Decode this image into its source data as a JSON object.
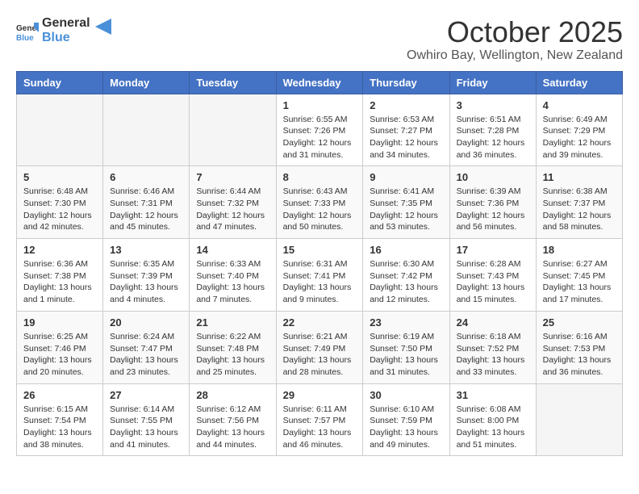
{
  "logo": {
    "general": "General",
    "blue": "Blue"
  },
  "title": "October 2025",
  "location": "Owhiro Bay, Wellington, New Zealand",
  "days_of_week": [
    "Sunday",
    "Monday",
    "Tuesday",
    "Wednesday",
    "Thursday",
    "Friday",
    "Saturday"
  ],
  "weeks": [
    [
      {
        "day": "",
        "info": ""
      },
      {
        "day": "",
        "info": ""
      },
      {
        "day": "",
        "info": ""
      },
      {
        "day": "1",
        "info": "Sunrise: 6:55 AM\nSunset: 7:26 PM\nDaylight: 12 hours and 31 minutes."
      },
      {
        "day": "2",
        "info": "Sunrise: 6:53 AM\nSunset: 7:27 PM\nDaylight: 12 hours and 34 minutes."
      },
      {
        "day": "3",
        "info": "Sunrise: 6:51 AM\nSunset: 7:28 PM\nDaylight: 12 hours and 36 minutes."
      },
      {
        "day": "4",
        "info": "Sunrise: 6:49 AM\nSunset: 7:29 PM\nDaylight: 12 hours and 39 minutes."
      }
    ],
    [
      {
        "day": "5",
        "info": "Sunrise: 6:48 AM\nSunset: 7:30 PM\nDaylight: 12 hours and 42 minutes."
      },
      {
        "day": "6",
        "info": "Sunrise: 6:46 AM\nSunset: 7:31 PM\nDaylight: 12 hours and 45 minutes."
      },
      {
        "day": "7",
        "info": "Sunrise: 6:44 AM\nSunset: 7:32 PM\nDaylight: 12 hours and 47 minutes."
      },
      {
        "day": "8",
        "info": "Sunrise: 6:43 AM\nSunset: 7:33 PM\nDaylight: 12 hours and 50 minutes."
      },
      {
        "day": "9",
        "info": "Sunrise: 6:41 AM\nSunset: 7:35 PM\nDaylight: 12 hours and 53 minutes."
      },
      {
        "day": "10",
        "info": "Sunrise: 6:39 AM\nSunset: 7:36 PM\nDaylight: 12 hours and 56 minutes."
      },
      {
        "day": "11",
        "info": "Sunrise: 6:38 AM\nSunset: 7:37 PM\nDaylight: 12 hours and 58 minutes."
      }
    ],
    [
      {
        "day": "12",
        "info": "Sunrise: 6:36 AM\nSunset: 7:38 PM\nDaylight: 13 hours and 1 minute."
      },
      {
        "day": "13",
        "info": "Sunrise: 6:35 AM\nSunset: 7:39 PM\nDaylight: 13 hours and 4 minutes."
      },
      {
        "day": "14",
        "info": "Sunrise: 6:33 AM\nSunset: 7:40 PM\nDaylight: 13 hours and 7 minutes."
      },
      {
        "day": "15",
        "info": "Sunrise: 6:31 AM\nSunset: 7:41 PM\nDaylight: 13 hours and 9 minutes."
      },
      {
        "day": "16",
        "info": "Sunrise: 6:30 AM\nSunset: 7:42 PM\nDaylight: 13 hours and 12 minutes."
      },
      {
        "day": "17",
        "info": "Sunrise: 6:28 AM\nSunset: 7:43 PM\nDaylight: 13 hours and 15 minutes."
      },
      {
        "day": "18",
        "info": "Sunrise: 6:27 AM\nSunset: 7:45 PM\nDaylight: 13 hours and 17 minutes."
      }
    ],
    [
      {
        "day": "19",
        "info": "Sunrise: 6:25 AM\nSunset: 7:46 PM\nDaylight: 13 hours and 20 minutes."
      },
      {
        "day": "20",
        "info": "Sunrise: 6:24 AM\nSunset: 7:47 PM\nDaylight: 13 hours and 23 minutes."
      },
      {
        "day": "21",
        "info": "Sunrise: 6:22 AM\nSunset: 7:48 PM\nDaylight: 13 hours and 25 minutes."
      },
      {
        "day": "22",
        "info": "Sunrise: 6:21 AM\nSunset: 7:49 PM\nDaylight: 13 hours and 28 minutes."
      },
      {
        "day": "23",
        "info": "Sunrise: 6:19 AM\nSunset: 7:50 PM\nDaylight: 13 hours and 31 minutes."
      },
      {
        "day": "24",
        "info": "Sunrise: 6:18 AM\nSunset: 7:52 PM\nDaylight: 13 hours and 33 minutes."
      },
      {
        "day": "25",
        "info": "Sunrise: 6:16 AM\nSunset: 7:53 PM\nDaylight: 13 hours and 36 minutes."
      }
    ],
    [
      {
        "day": "26",
        "info": "Sunrise: 6:15 AM\nSunset: 7:54 PM\nDaylight: 13 hours and 38 minutes."
      },
      {
        "day": "27",
        "info": "Sunrise: 6:14 AM\nSunset: 7:55 PM\nDaylight: 13 hours and 41 minutes."
      },
      {
        "day": "28",
        "info": "Sunrise: 6:12 AM\nSunset: 7:56 PM\nDaylight: 13 hours and 44 minutes."
      },
      {
        "day": "29",
        "info": "Sunrise: 6:11 AM\nSunset: 7:57 PM\nDaylight: 13 hours and 46 minutes."
      },
      {
        "day": "30",
        "info": "Sunrise: 6:10 AM\nSunset: 7:59 PM\nDaylight: 13 hours and 49 minutes."
      },
      {
        "day": "31",
        "info": "Sunrise: 6:08 AM\nSunset: 8:00 PM\nDaylight: 13 hours and 51 minutes."
      },
      {
        "day": "",
        "info": ""
      }
    ]
  ]
}
